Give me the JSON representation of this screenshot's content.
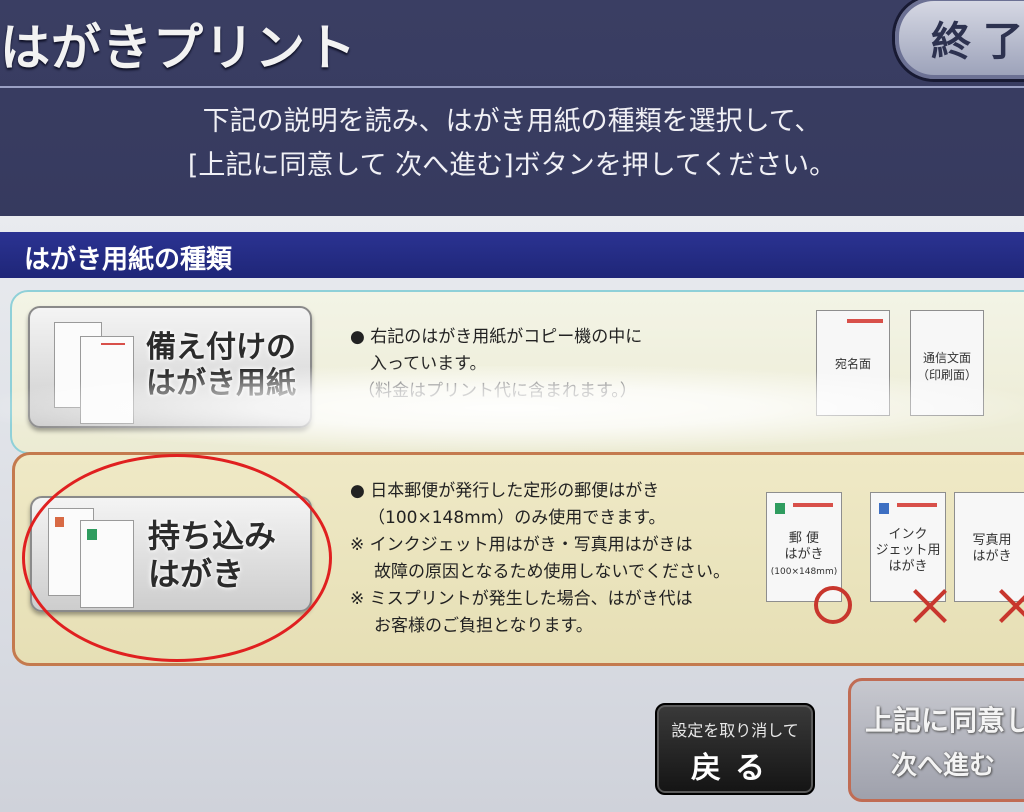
{
  "header": {
    "title": "はがきプリント",
    "end_button": "終了"
  },
  "instruction": {
    "line1": "下記の説明を読み、はがき用紙の種類を選択して、",
    "line2": "[上記に同意して 次へ進む]ボタンを押してください。"
  },
  "section": {
    "title": "はがき用紙の種類"
  },
  "option1": {
    "button_line1": "備え付けの",
    "button_line2": "はがき用紙",
    "bullet1": "● 右記のはがき用紙がコピー機の中に",
    "bullet1b": "入っています。",
    "bullet1c": "（料金はプリント代に含まれます。）",
    "thumb_address": "宛名面",
    "thumb_message_1": "通信文面",
    "thumb_message_2": "（印刷面）"
  },
  "option2": {
    "button_line1": "持ち込み",
    "button_line2": "はがき",
    "bullet1": "● 日本郵便が発行した定形の郵便はがき",
    "bullet1b": "（100×148mm）のみ使用できます。",
    "note1": "※ インクジェット用はがき・写真用はがきは",
    "note1b": "故障の原因となるため使用しないでください。",
    "note2": "※ ミスプリントが発生した場合、はがき代は",
    "note2b": "お客様のご負担となります。",
    "thumb1_1": "郵 便",
    "thumb1_2": "はがき",
    "thumb1_3": "(100×148mm)",
    "thumb2_1": "インク",
    "thumb2_2": "ジェット用",
    "thumb2_3": "はがき",
    "thumb3_1": "写真用",
    "thumb3_2": "はがき"
  },
  "footer": {
    "back_small": "設定を取り消して",
    "back_big": "戻る",
    "next_line1": "上記に同意して",
    "next_line2": "次へ進む"
  },
  "colors": {
    "header_bg": "#2c2f52",
    "section_bar": "#1f2678",
    "selection_circle": "#e02020"
  }
}
